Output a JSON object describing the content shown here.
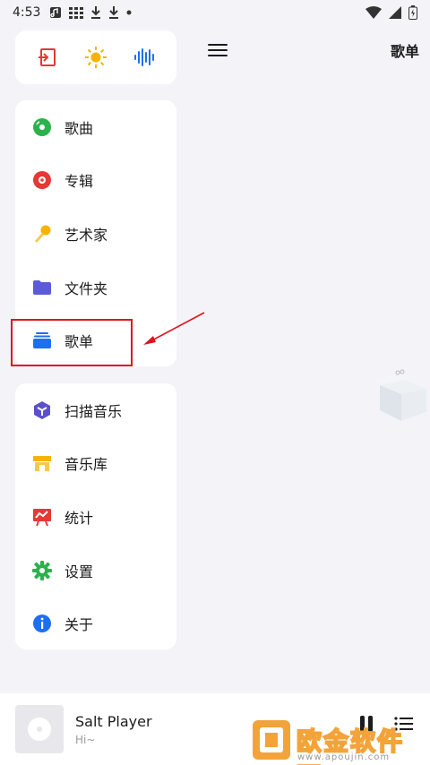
{
  "status_bar": {
    "time": "4:53"
  },
  "main": {
    "title": "歌单"
  },
  "drawer": {
    "nav_items": [
      {
        "label": "歌曲",
        "icon": "disc-green-icon",
        "color": "#2bb24c"
      },
      {
        "label": "专辑",
        "icon": "record-red-icon",
        "color": "#e53935"
      },
      {
        "label": "艺术家",
        "icon": "microphone-icon",
        "color": "#f5b400"
      },
      {
        "label": "文件夹",
        "icon": "folder-icon",
        "color": "#5b5bd6"
      },
      {
        "label": "歌单",
        "icon": "playlist-icon",
        "color": "#1e6ff0"
      }
    ],
    "tool_items": [
      {
        "label": "扫描音乐",
        "icon": "scan-cube-icon",
        "color": "#5b4fcf"
      },
      {
        "label": "音乐库",
        "icon": "store-icon",
        "color": "#f5b400"
      },
      {
        "label": "统计",
        "icon": "chart-board-icon",
        "color": "#e53935"
      },
      {
        "label": "设置",
        "icon": "gear-icon",
        "color": "#2bb24c"
      },
      {
        "label": "关于",
        "icon": "info-icon",
        "color": "#1e6ff0"
      }
    ]
  },
  "player": {
    "title": "Salt Player",
    "subtitle": "Hi~"
  },
  "watermark": {
    "text": "欧金软件园",
    "url": "www.apoujin.com"
  },
  "colors": {
    "background": "#f4f4f8",
    "card": "#ffffff",
    "highlight": "#e0141e"
  }
}
